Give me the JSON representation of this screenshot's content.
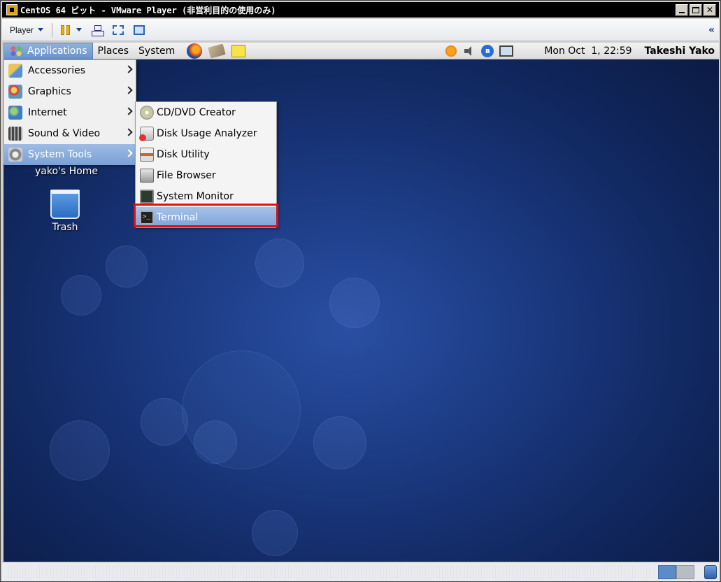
{
  "window": {
    "title": "CentOS 64 ビット - VMware Player (非営利目的の使用のみ)"
  },
  "vmware_toolbar": {
    "player_label": "Player",
    "collapse_glyph": "«"
  },
  "panel": {
    "menus": [
      "Applications",
      "Places",
      "System"
    ],
    "clock": "Mon Oct  1, 22:59",
    "user": "Takeshi Yako"
  },
  "desktop": {
    "home_label": "yako's Home",
    "trash_label": "Trash"
  },
  "applications_menu": {
    "items": [
      {
        "label": "Accessories",
        "icon": "accessories-icon"
      },
      {
        "label": "Graphics",
        "icon": "graphics-icon"
      },
      {
        "label": "Internet",
        "icon": "internet-icon"
      },
      {
        "label": "Sound & Video",
        "icon": "sound-video-icon"
      },
      {
        "label": "System Tools",
        "icon": "system-tools-icon",
        "highlighted": true
      }
    ]
  },
  "system_tools_menu": {
    "items": [
      {
        "label": "CD/DVD Creator",
        "icon": "cd-icon"
      },
      {
        "label": "Disk Usage Analyzer",
        "icon": "disk-usage-icon"
      },
      {
        "label": "Disk Utility",
        "icon": "disk-utility-icon"
      },
      {
        "label": "File Browser",
        "icon": "file-browser-icon"
      },
      {
        "label": "System Monitor",
        "icon": "system-monitor-icon"
      },
      {
        "label": "Terminal",
        "icon": "terminal-icon",
        "highlighted": true
      }
    ]
  },
  "colors": {
    "highlight": "#7aa0d6",
    "annotation_box": "#e01010",
    "desktop_bg": "#1b3a82"
  }
}
